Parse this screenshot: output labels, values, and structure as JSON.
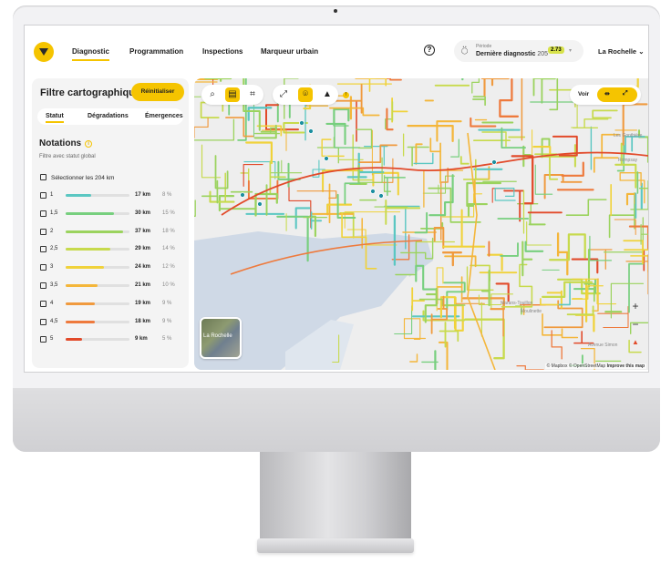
{
  "nav": {
    "tabs": [
      "Diagnostic",
      "Programmation",
      "Inspections",
      "Marqueur urbain"
    ],
    "period_caption": "Période",
    "period_value": "Dernière diagnostic",
    "period_count": "205",
    "period_badge": "2.73",
    "city": "La Rochelle"
  },
  "panel": {
    "title": "Filtre cartographique:",
    "reset_label": "Réinitialiser",
    "subtabs": [
      "Statut",
      "Dégradations",
      "Émergences"
    ],
    "notations_title": "Notations",
    "notations_subtitle": "Filtre avec statut global",
    "select_all": "Sélectionner les 204 km",
    "ratings": [
      {
        "label": "1",
        "km": "17 km",
        "pct": "8 %",
        "share": 8,
        "color": "#5bc7c2"
      },
      {
        "label": "1,5",
        "km": "30 km",
        "pct": "15 %",
        "share": 15,
        "color": "#77cf7e"
      },
      {
        "label": "2",
        "km": "37 km",
        "pct": "18 %",
        "share": 18,
        "color": "#9bd35e"
      },
      {
        "label": "2,5",
        "km": "29 km",
        "pct": "14 %",
        "share": 14,
        "color": "#c7da4c"
      },
      {
        "label": "3",
        "km": "24 km",
        "pct": "12 %",
        "share": 12,
        "color": "#f0d23a"
      },
      {
        "label": "3,5",
        "km": "21 km",
        "pct": "10 %",
        "share": 10,
        "color": "#f4b63a"
      },
      {
        "label": "4",
        "km": "19 km",
        "pct": "9 %",
        "share": 9,
        "color": "#f09a3e"
      },
      {
        "label": "4,5",
        "km": "18 km",
        "pct": "9 %",
        "share": 9,
        "color": "#ee7a3d"
      },
      {
        "label": "5",
        "km": "9 km",
        "pct": "5 %",
        "share": 5,
        "color": "#e24a2a"
      }
    ]
  },
  "map": {
    "voir_label": "Voir",
    "minimap_label": "La Rochelle",
    "attribution_prefix": "© Mapbox © OpenStreetMap",
    "attribution_link": "Improve this map",
    "places": [
      "Les Gonthière",
      "Rompsay",
      "Marans-Touillon",
      "Moulinette",
      "Avenue Simon"
    ],
    "zoom_in": "+",
    "zoom_out": "−"
  },
  "colors": {
    "accent": "#f5c400",
    "water": "#cfd9e6",
    "land": "#eeeeee"
  }
}
